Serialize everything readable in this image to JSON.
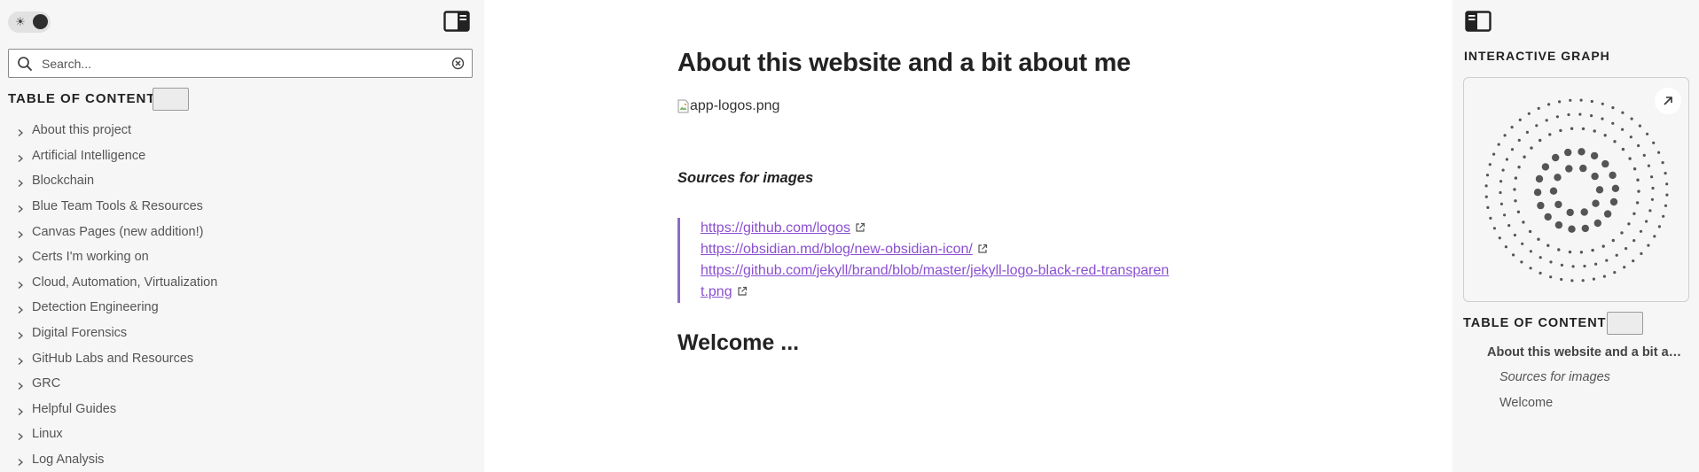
{
  "left_sidebar": {
    "search_placeholder": "Search...",
    "toc_heading": "TABLE OF CONTENTS",
    "items": [
      {
        "label": "About this project"
      },
      {
        "label": "Artificial Intelligence"
      },
      {
        "label": "Blockchain"
      },
      {
        "label": "Blue Team Tools & Resources"
      },
      {
        "label": "Canvas Pages (new addition!)"
      },
      {
        "label": "Certs I'm working on"
      },
      {
        "label": "Cloud, Automation, Virtualization"
      },
      {
        "label": "Detection Engineering"
      },
      {
        "label": "Digital Forensics"
      },
      {
        "label": "GitHub Labs and Resources"
      },
      {
        "label": "GRC"
      },
      {
        "label": "Helpful Guides"
      },
      {
        "label": "Linux"
      },
      {
        "label": "Log Analysis"
      }
    ]
  },
  "main": {
    "title": "About this website and a bit about me",
    "image_alt": "app-logos.png",
    "sources_heading": "Sources for images",
    "links": [
      "https://github.com/logos",
      "https://obsidian.md/blog/new-obsidian-icon/",
      "https://github.com/jekyll/brand/blob/master/jekyll-logo-black-red-transparent.png"
    ],
    "welcome_heading": "Welcome ..."
  },
  "right_sidebar": {
    "graph_heading": "INTERACTIVE GRAPH",
    "toc_heading": "TABLE OF CONTENTS",
    "toc_items": [
      {
        "label": "About this website and a bit about me",
        "level": 1,
        "active": true
      },
      {
        "label": "Sources for images",
        "level": 2
      },
      {
        "label": "Welcome",
        "level": 2
      }
    ]
  },
  "colors": {
    "sidebar_bg": "#f6f6f6",
    "link": "#8b4fd1",
    "blockquote_border": "#8b6cc9",
    "graph_node": "#555555"
  }
}
